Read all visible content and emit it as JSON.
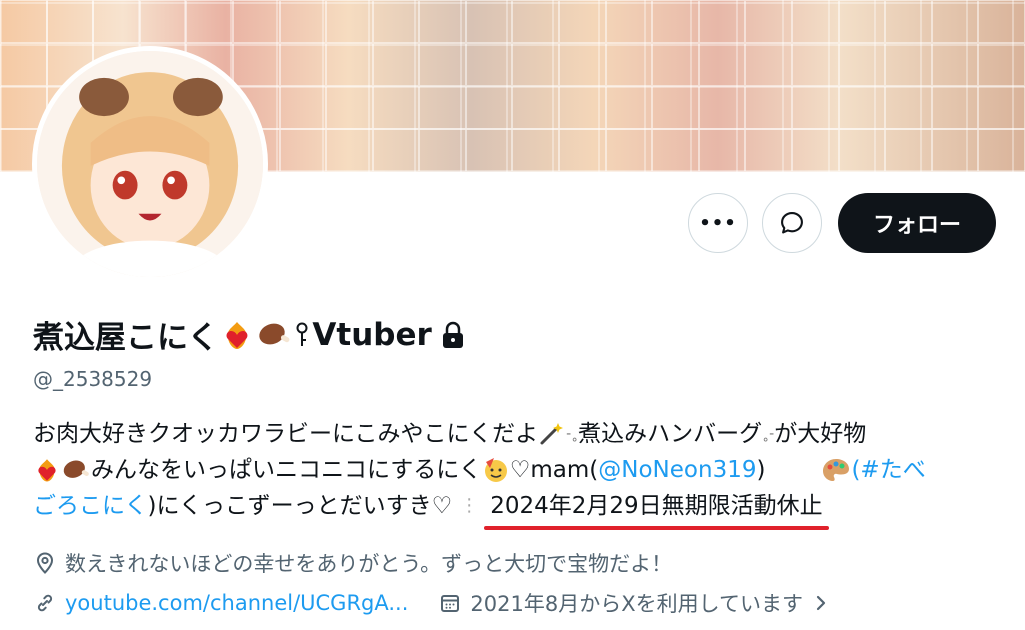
{
  "banner": {
    "description_icon": "collage-banner"
  },
  "profile": {
    "display_name": "煮込屋こにく",
    "display_name_suffix": "Vtuber",
    "handle": "@_2538529",
    "bio": {
      "line1": "お肉大好きクオッカワラビーにこみやこにくだよ",
      "line1b": "煮込みハンバーグ",
      "line1c": "が大好物",
      "line2a": "みんなをいっぱいニコニコにするにく",
      "line2b": "♡mam(",
      "line2_mention": "@NoNeon319",
      "line2c": ")",
      "line2_hashtag_start": "(#たべ",
      "line3_hashtag_end": "ごろこにく",
      "line3a": ")にくっこずーっとだいすき♡",
      "line3_date": "2024年2月29日無期限活動休止"
    },
    "location": "数えきれないほどの幸せをありがとう。ずっと大切で宝物だよ！",
    "website": "youtube.com/channel/UCGRgA...",
    "joined": "2021年8月からXを利用しています"
  },
  "actions": {
    "more_label": "•••",
    "follow_label": "フォロー"
  },
  "colors": {
    "link": "#1d9bf0",
    "text": "#0f1419",
    "secondary": "#536471",
    "follow_bg": "#0f1419",
    "underline": "#e0212b"
  }
}
